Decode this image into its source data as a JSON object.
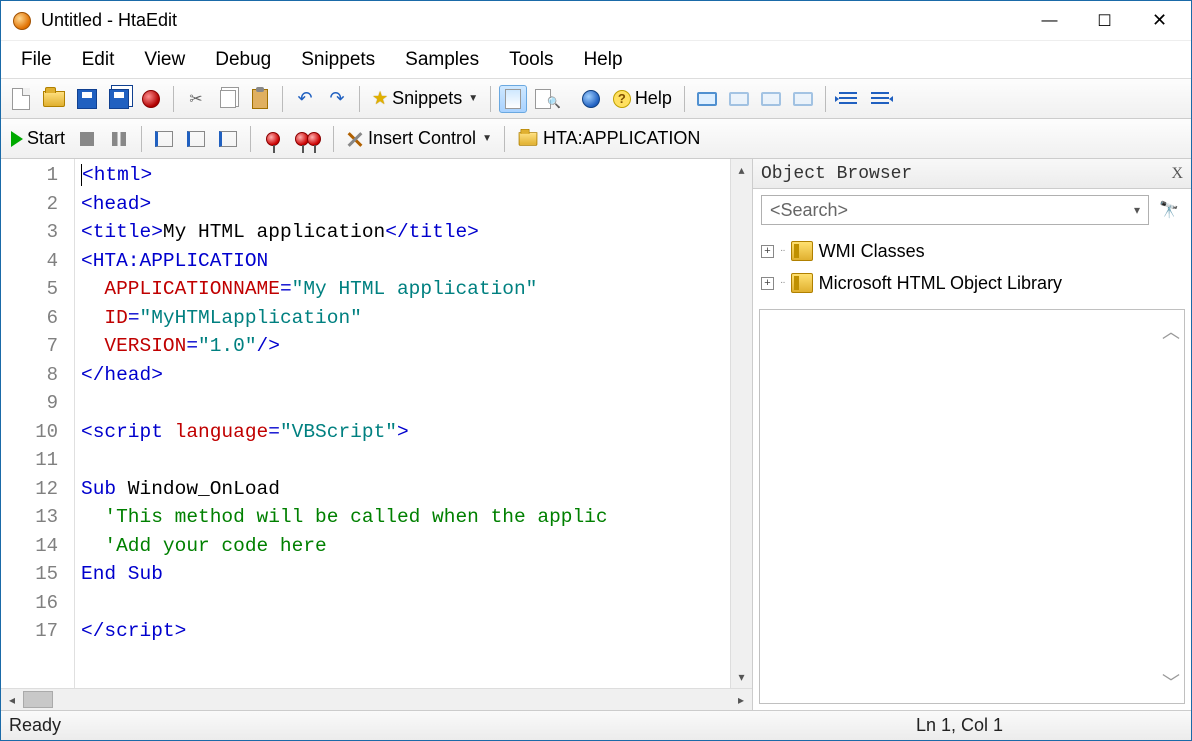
{
  "window": {
    "title": "Untitled - HtaEdit"
  },
  "menu": [
    "File",
    "Edit",
    "View",
    "Debug",
    "Snippets",
    "Samples",
    "Tools",
    "Help"
  ],
  "toolbar1": {
    "snippets_label": "Snippets",
    "help_label": "Help"
  },
  "toolbar2": {
    "start_label": "Start",
    "insert_control_label": "Insert Control",
    "hta_app_label": "HTA:APPLICATION"
  },
  "editor": {
    "lines": [
      {
        "n": 1,
        "seg": [
          {
            "c": "t-blue",
            "t": "<html>"
          }
        ]
      },
      {
        "n": 2,
        "seg": [
          {
            "c": "t-blue",
            "t": "<head>"
          }
        ]
      },
      {
        "n": 3,
        "seg": [
          {
            "c": "t-blue",
            "t": "<title>"
          },
          {
            "c": "",
            "t": "My HTML application"
          },
          {
            "c": "t-blue",
            "t": "</title>"
          }
        ]
      },
      {
        "n": 4,
        "seg": [
          {
            "c": "t-blue",
            "t": "<HTA:APPLICATION"
          }
        ]
      },
      {
        "n": 5,
        "seg": [
          {
            "c": "",
            "t": "  "
          },
          {
            "c": "t-red",
            "t": "APPLICATIONNAME"
          },
          {
            "c": "t-blue",
            "t": "="
          },
          {
            "c": "t-teal",
            "t": "\"My HTML application\""
          }
        ]
      },
      {
        "n": 6,
        "seg": [
          {
            "c": "",
            "t": "  "
          },
          {
            "c": "t-red",
            "t": "ID"
          },
          {
            "c": "t-blue",
            "t": "="
          },
          {
            "c": "t-teal",
            "t": "\"MyHTMLapplication\""
          }
        ]
      },
      {
        "n": 7,
        "seg": [
          {
            "c": "",
            "t": "  "
          },
          {
            "c": "t-red",
            "t": "VERSION"
          },
          {
            "c": "t-blue",
            "t": "="
          },
          {
            "c": "t-teal",
            "t": "\"1.0\""
          },
          {
            "c": "t-blue",
            "t": "/>"
          }
        ]
      },
      {
        "n": 8,
        "seg": [
          {
            "c": "t-blue",
            "t": "</head>"
          }
        ]
      },
      {
        "n": 9,
        "seg": [
          {
            "c": "",
            "t": ""
          }
        ]
      },
      {
        "n": 10,
        "seg": [
          {
            "c": "t-blue",
            "t": "<script "
          },
          {
            "c": "t-red",
            "t": "language"
          },
          {
            "c": "t-blue",
            "t": "="
          },
          {
            "c": "t-teal",
            "t": "\"VBScript\""
          },
          {
            "c": "t-blue",
            "t": ">"
          }
        ]
      },
      {
        "n": 11,
        "seg": [
          {
            "c": "",
            "t": ""
          }
        ]
      },
      {
        "n": 12,
        "seg": [
          {
            "c": "t-blue",
            "t": "Sub"
          },
          {
            "c": "",
            "t": " Window_OnLoad"
          }
        ]
      },
      {
        "n": 13,
        "seg": [
          {
            "c": "",
            "t": "  "
          },
          {
            "c": "t-green",
            "t": "'This method will be called when the applic"
          }
        ]
      },
      {
        "n": 14,
        "seg": [
          {
            "c": "",
            "t": "  "
          },
          {
            "c": "t-green",
            "t": "'Add your code here"
          }
        ]
      },
      {
        "n": 15,
        "seg": [
          {
            "c": "t-blue",
            "t": "End Sub"
          }
        ]
      },
      {
        "n": 16,
        "seg": [
          {
            "c": "",
            "t": ""
          }
        ]
      },
      {
        "n": 17,
        "seg": [
          {
            "c": "t-blue",
            "t": "</script>"
          }
        ]
      }
    ]
  },
  "object_browser": {
    "title": "Object Browser",
    "search_placeholder": "<Search>",
    "items": [
      "WMI Classes",
      "Microsoft HTML Object Library"
    ]
  },
  "status": {
    "left": "Ready",
    "right": "Ln 1, Col 1"
  }
}
